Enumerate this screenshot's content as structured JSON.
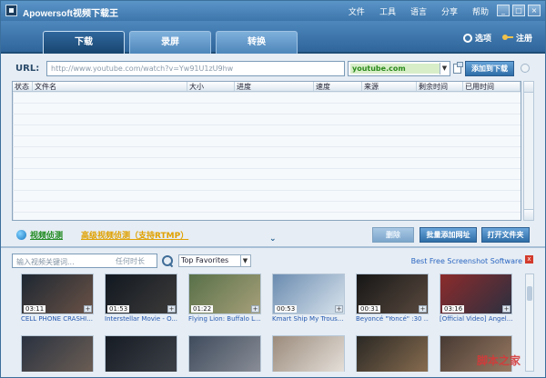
{
  "window": {
    "title": "Apowersoft视频下载王"
  },
  "menu": [
    "文件",
    "工具",
    "语言",
    "分享",
    "帮助"
  ],
  "window_controls": {
    "minimize": "_",
    "maximize": "□",
    "close": "×"
  },
  "tabs": [
    {
      "label": "下载"
    },
    {
      "label": "录屏"
    },
    {
      "label": "转换"
    }
  ],
  "top_actions": {
    "options": "选项",
    "register": "注册"
  },
  "url": {
    "label": "URL:",
    "placeholder": "http://www.youtube.com/watch?v=Yw91U1zU9hw",
    "site": "youtube.com",
    "add_button": "添加到下载"
  },
  "table": {
    "headers": [
      "状态",
      "文件名",
      "大小",
      "进度",
      "速度",
      "来源",
      "剩余时间",
      "已用时间"
    ]
  },
  "bottom": {
    "sniffer": "视频侦测",
    "advanced": "高级视频侦测（支持RTMP）",
    "buttons": [
      "删除",
      "批量添加网址",
      "打开文件夹"
    ]
  },
  "search": {
    "placeholder": "输入视频关键词...",
    "time_label": "任何时长",
    "category": "Top Favorites",
    "promo": "Best Free Screenshot Software",
    "close": "x"
  },
  "videos": [
    {
      "time": "03:11",
      "title": "CELL PHONE CRASHI..."
    },
    {
      "time": "01:53",
      "title": "Interstellar Movie - O..."
    },
    {
      "time": "01:22",
      "title": "Flying Lion: Buffalo L..."
    },
    {
      "time": "00:53",
      "title": "Kmart Ship My Trous..."
    },
    {
      "time": "00:31",
      "title": "Beyoncé \"Yoncé\" :30 ..."
    },
    {
      "time": "03:16",
      "title": "[Official Video] Angel..."
    }
  ],
  "watermark": "脚本之家"
}
